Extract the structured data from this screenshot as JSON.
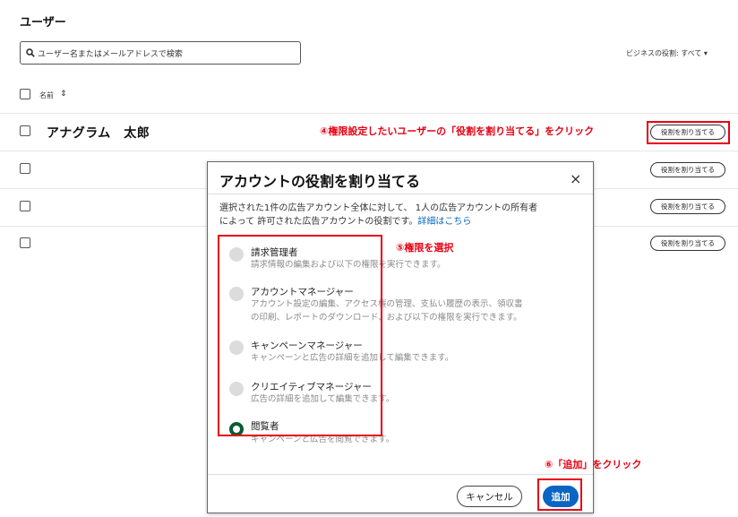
{
  "page": {
    "title": "ユーザー",
    "search_placeholder": "ユーザー名またはメールアドレスで検索",
    "business_role_filter": "ビジネスの役割: すべて ▾",
    "column_name": "名前",
    "sort_icon": "⇕"
  },
  "users": [
    {
      "name": "アナグラム　太郎",
      "assign_label": "役割を割り当てる"
    },
    {
      "name": "",
      "assign_label": "役割を割り当てる"
    },
    {
      "name": "",
      "assign_label": "役割を割り当てる"
    },
    {
      "name": "",
      "assign_label": "役割を割り当てる"
    }
  ],
  "annotations": {
    "step4": "④権限設定したいユーザーの「役割を割り当てる」をクリック",
    "step5": "⑤権限を選択",
    "step6": "⑥「追加」をクリック",
    "highlight_color": "#e60012"
  },
  "dialog": {
    "title": "アカウントの役割を割り当てる",
    "close": "×",
    "desc_line1": "選択された1件の広告アカウント全体に対して、 1人の広告アカウントの所有者",
    "desc_line2": "によって 許可された広告アカウントの役割です。",
    "details_link": "詳細はこちら",
    "roles": [
      {
        "name": "請求管理者",
        "desc1": "請求情報の編集および以下の権限を実行できます。",
        "desc2": "",
        "selected": false
      },
      {
        "name": "アカウントマネージャー",
        "desc1": "アカウント設定の編集、アクセス権の管理、支払い履歴の表示、領収書",
        "desc2": "の印刷、レポートのダウンロード、および以下の権限を実行できます。",
        "selected": false
      },
      {
        "name": "キャンペーンマネージャー",
        "desc1": "キャンペーンと広告の詳細を追加して編集できます。",
        "desc2": "",
        "selected": false
      },
      {
        "name": "クリエイティブマネージャー",
        "desc1": "広告の詳細を追加して編集できます。",
        "desc2": "",
        "selected": false
      },
      {
        "name": "閲覧者",
        "desc1": "キャンペーンと広告を閲覧できます。",
        "desc2": "",
        "selected": true
      }
    ],
    "cancel_label": "キャンセル",
    "add_label": "追加",
    "accent_color": "#0a66c2",
    "selected_radio_color": "#0b5a33"
  }
}
